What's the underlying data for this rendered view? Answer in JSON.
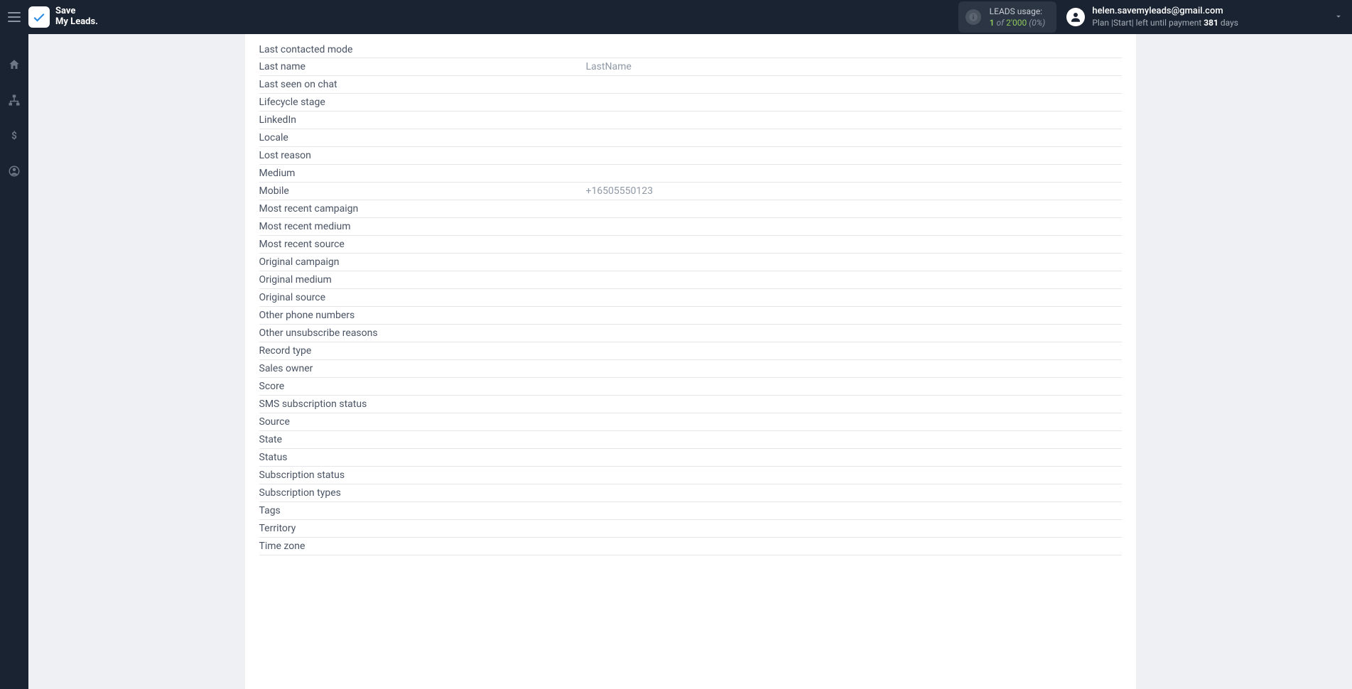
{
  "brand": {
    "line1": "Save",
    "line2": "My Leads."
  },
  "usage": {
    "label": "LEADS usage:",
    "count": "1",
    "of": "of",
    "total": "2'000",
    "pct": "(0%)"
  },
  "account": {
    "email": "helen.savemyleads@gmail.com",
    "plan_prefix": "Plan |Start| left until payment ",
    "days": "381",
    "days_suffix": " days"
  },
  "fields": [
    {
      "label": "Last contacted mode",
      "value": ""
    },
    {
      "label": "Last name",
      "value": "LastName"
    },
    {
      "label": "Last seen on chat",
      "value": ""
    },
    {
      "label": "Lifecycle stage",
      "value": ""
    },
    {
      "label": "LinkedIn",
      "value": ""
    },
    {
      "label": "Locale",
      "value": ""
    },
    {
      "label": "Lost reason",
      "value": ""
    },
    {
      "label": "Medium",
      "value": ""
    },
    {
      "label": "Mobile",
      "value": "+16505550123"
    },
    {
      "label": "Most recent campaign",
      "value": ""
    },
    {
      "label": "Most recent medium",
      "value": ""
    },
    {
      "label": "Most recent source",
      "value": ""
    },
    {
      "label": "Original campaign",
      "value": ""
    },
    {
      "label": "Original medium",
      "value": ""
    },
    {
      "label": "Original source",
      "value": ""
    },
    {
      "label": "Other phone numbers",
      "value": ""
    },
    {
      "label": "Other unsubscribe reasons",
      "value": ""
    },
    {
      "label": "Record type",
      "value": ""
    },
    {
      "label": "Sales owner",
      "value": ""
    },
    {
      "label": "Score",
      "value": ""
    },
    {
      "label": "SMS subscription status",
      "value": ""
    },
    {
      "label": "Source",
      "value": ""
    },
    {
      "label": "State",
      "value": ""
    },
    {
      "label": "Status",
      "value": ""
    },
    {
      "label": "Subscription status",
      "value": ""
    },
    {
      "label": "Subscription types",
      "value": ""
    },
    {
      "label": "Tags",
      "value": ""
    },
    {
      "label": "Territory",
      "value": ""
    },
    {
      "label": "Time zone",
      "value": ""
    }
  ]
}
